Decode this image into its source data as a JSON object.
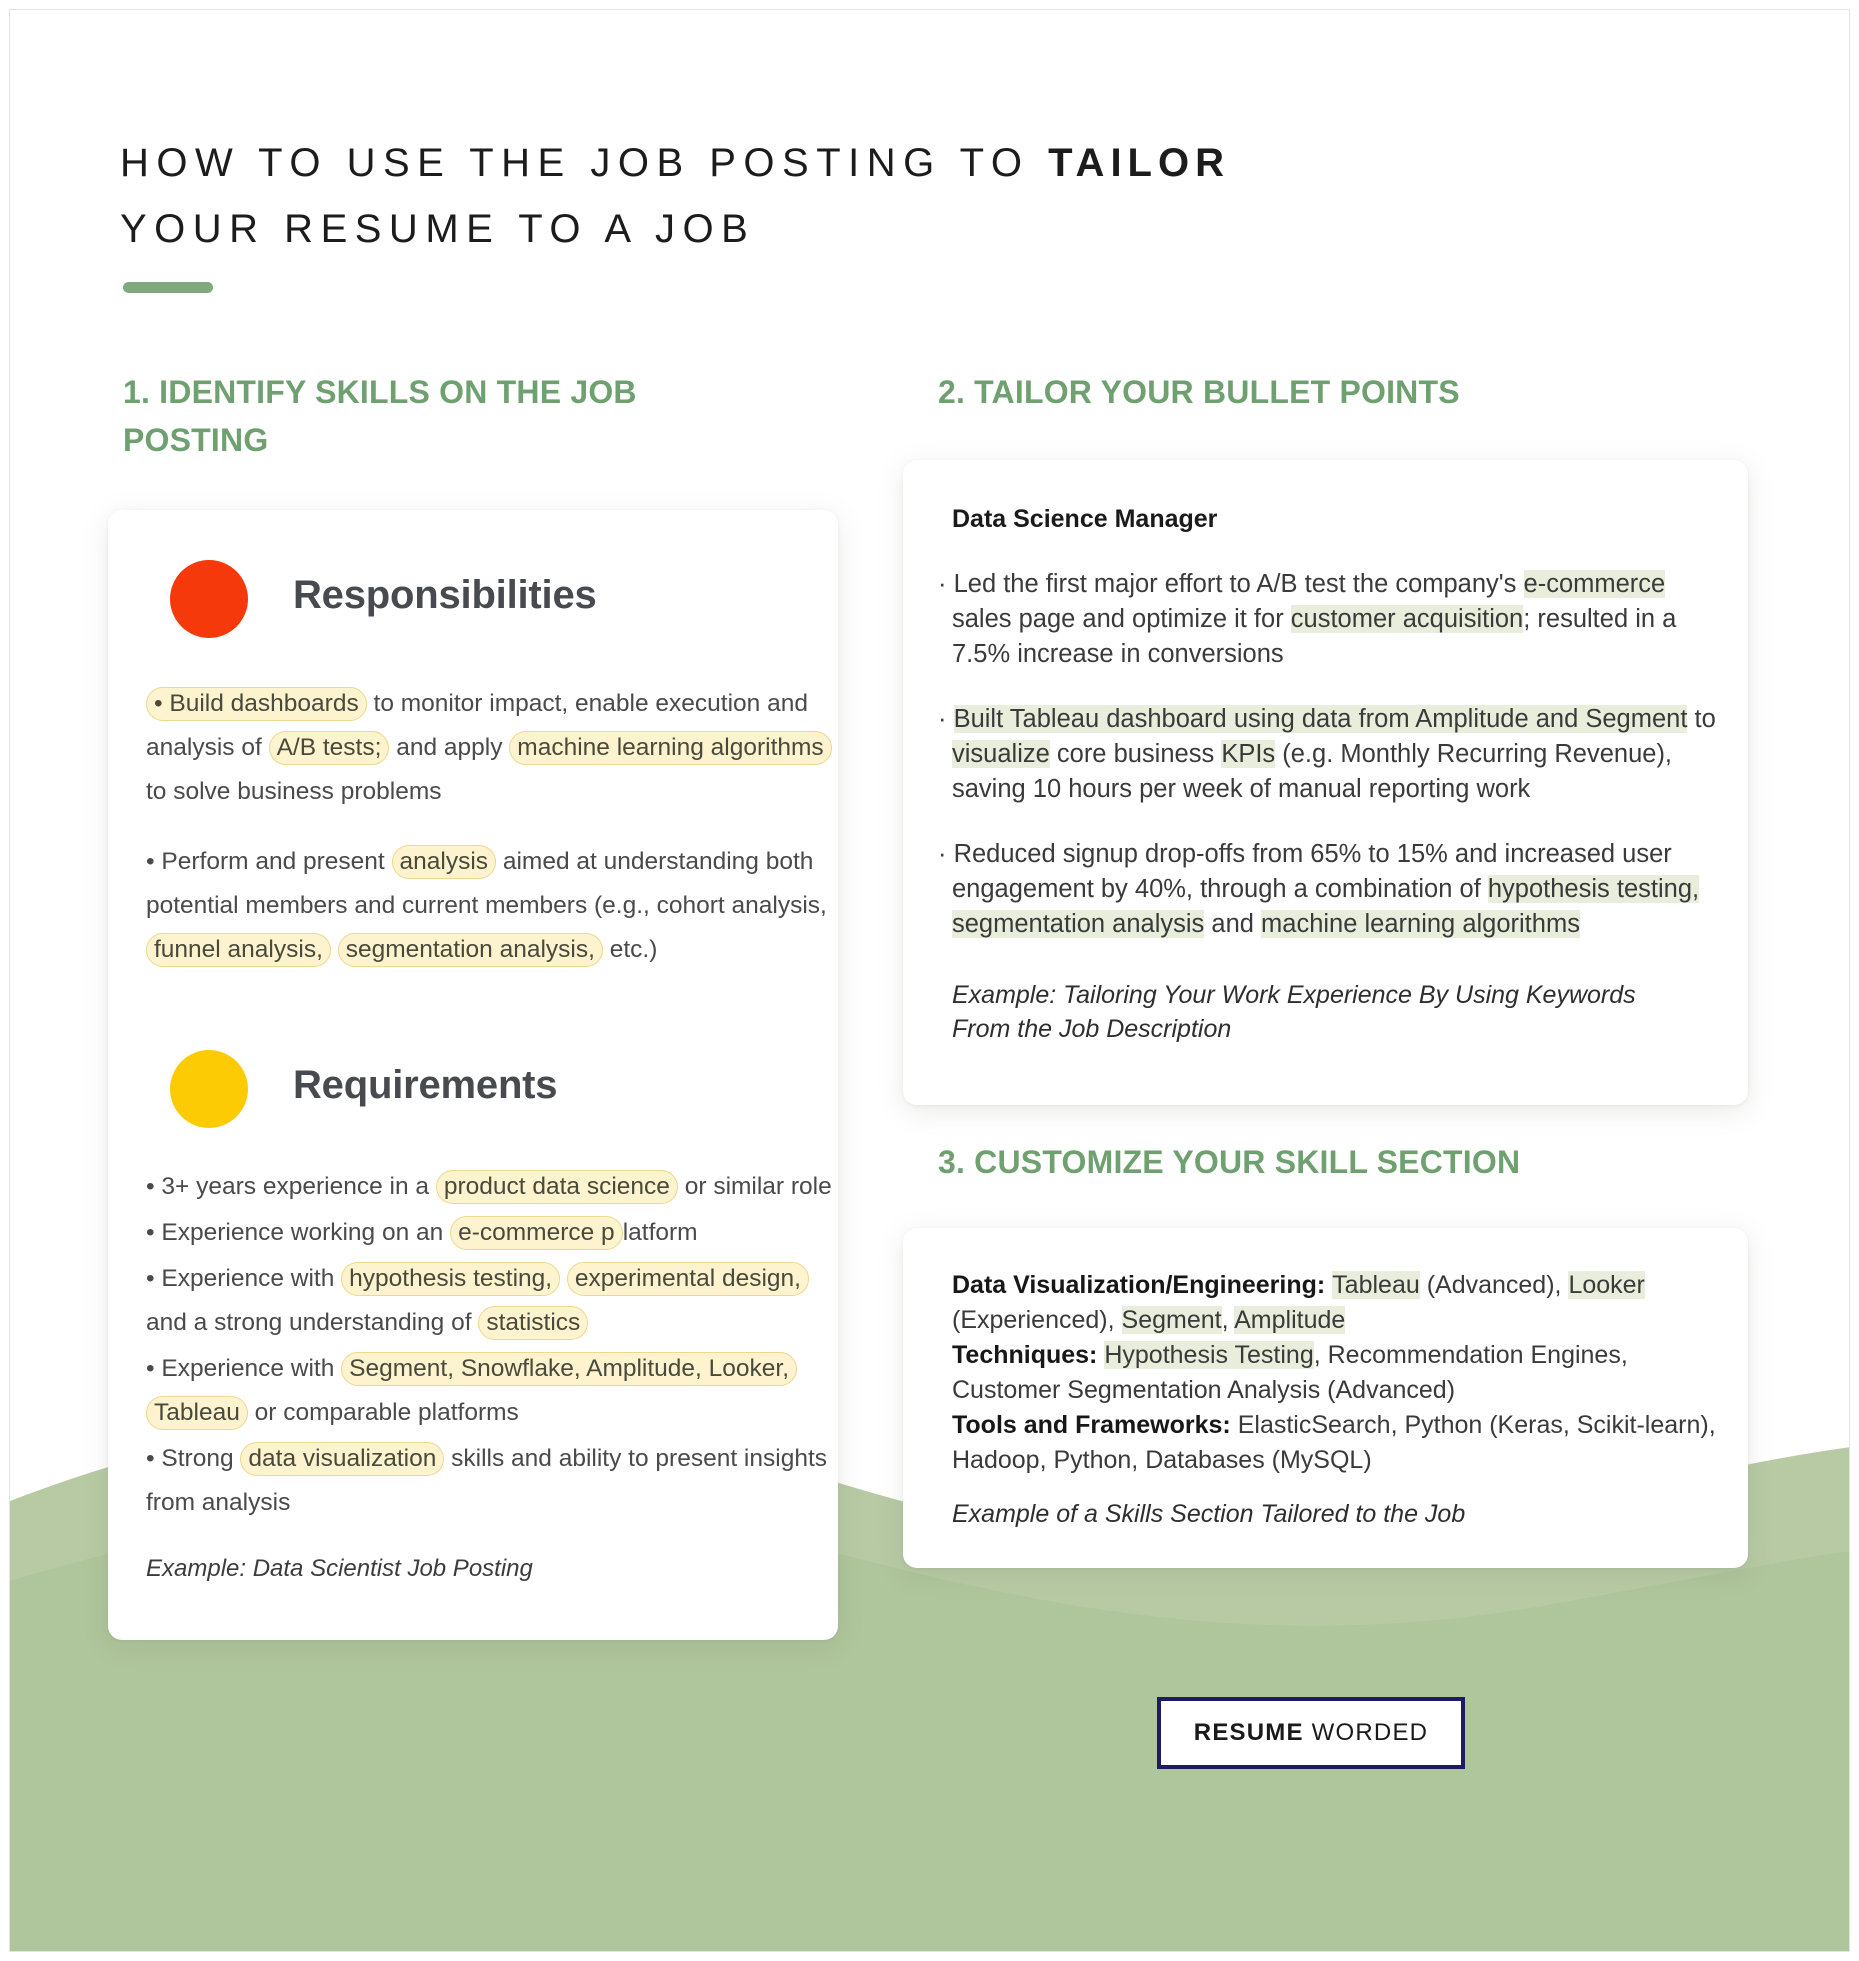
{
  "title": {
    "line1_before": "HOW TO USE THE JOB POSTING TO ",
    "line1_bold": "TAILOR",
    "line2": "YOUR RESUME TO A JOB"
  },
  "colors": {
    "accent_green": "#7fa97f",
    "heading_green": "#6fa06f",
    "responsibilities_dot": "#f5390a",
    "requirements_dot": "#fdcb03",
    "highlight_yellow": "#fdf4cf",
    "highlight_green": "#e9eedc",
    "logo_border_navy": "#1e1b63",
    "wave_green": "#aec49a"
  },
  "sections": {
    "one": {
      "heading": "1. IDENTIFY SKILLS ON THE JOB POSTING"
    },
    "two": {
      "heading": "2. TAILOR YOUR BULLET POINTS"
    },
    "three": {
      "heading": "3. CUSTOMIZE YOUR SKILL SECTION"
    }
  },
  "job_posting_card": {
    "responsibilities": {
      "label": "Responsibilities",
      "dot_icon": "red-circle-icon",
      "bullets": [
        [
          {
            "t": "• Build dashboards",
            "h": "yellow"
          },
          {
            "t": " to monitor impact, enable execution and analysis of ",
            "h": "none"
          },
          {
            "t": "A/B tests;",
            "h": "yellow"
          },
          {
            "t": " and apply ",
            "h": "none"
          },
          {
            "t": "machine learning algorithms",
            "h": "yellow"
          },
          {
            "t": " to solve business problems",
            "h": "none"
          }
        ],
        [
          {
            "t": "• Perform and present ",
            "h": "none"
          },
          {
            "t": "analysis",
            "h": "yellow"
          },
          {
            "t": " aimed at understanding both potential members and current members (e.g., cohort analysis, ",
            "h": "none"
          },
          {
            "t": "funnel analysis,",
            "h": "yellow"
          },
          {
            "t": " ",
            "h": "none"
          },
          {
            "t": "segmentation analysis,",
            "h": "yellow"
          },
          {
            "t": " etc.)",
            "h": "none"
          }
        ]
      ]
    },
    "requirements": {
      "label": "Requirements",
      "dot_icon": "yellow-circle-icon",
      "bullets": [
        [
          {
            "t": "• 3+ years experience in a ",
            "h": "none"
          },
          {
            "t": "product data science",
            "h": "yellow"
          },
          {
            "t": " or similar role",
            "h": "none"
          }
        ],
        [
          {
            "t": "• Experience working on an ",
            "h": "none"
          },
          {
            "t": "e-commerce p",
            "h": "yellow"
          },
          {
            "t": "latform",
            "h": "none"
          }
        ],
        [
          {
            "t": "• Experience with ",
            "h": "none"
          },
          {
            "t": "hypothesis testing,",
            "h": "yellow"
          },
          {
            "t": " ",
            "h": "none"
          },
          {
            "t": "experimental design,",
            "h": "yellow"
          },
          {
            "t": " and a strong understanding of ",
            "h": "none"
          },
          {
            "t": "statistics",
            "h": "yellow"
          }
        ],
        [
          {
            "t": "• Experience with ",
            "h": "none"
          },
          {
            "t": "Segment, Snowflake, Amplitude, Looker,",
            "h": "yellow"
          },
          {
            "t": " ",
            "h": "none"
          },
          {
            "t": "Tableau",
            "h": "yellow"
          },
          {
            "t": " or comparable platforms",
            "h": "none"
          }
        ],
        [
          {
            "t": "• Strong ",
            "h": "none"
          },
          {
            "t": "data visualization",
            "h": "yellow"
          },
          {
            "t": " skills and ability to present insights from analysis",
            "h": "none"
          }
        ]
      ]
    },
    "example_note": "Example: Data Scientist Job Posting"
  },
  "bullet_points_card": {
    "job_title": "Data Science Manager",
    "bullets": [
      [
        {
          "t": "· Led the first major effort to A/B test the company's ",
          "h": "none"
        },
        {
          "t": "e-commerce",
          "h": "green"
        },
        {
          "t": " sales page and optimize it for ",
          "h": "none"
        },
        {
          "t": "customer acquisition",
          "h": "green"
        },
        {
          "t": "; resulted in a 7.5% increase in conversions",
          "h": "none"
        }
      ],
      [
        {
          "t": "· ",
          "h": "none"
        },
        {
          "t": "Built Tableau dashboard using data from Amplitude and Segment",
          "h": "green"
        },
        {
          "t": " to ",
          "h": "none"
        },
        {
          "t": "visualize",
          "h": "green"
        },
        {
          "t": " core business ",
          "h": "none"
        },
        {
          "t": "KPIs",
          "h": "green"
        },
        {
          "t": " (e.g. Monthly Recurring Revenue), saving 10 hours per week of manual reporting work",
          "h": "none"
        }
      ],
      [
        {
          "t": "· Reduced signup drop-offs from 65% to 15% and increased user engagement by 40%, through a combination of ",
          "h": "none"
        },
        {
          "t": "hypothesis testing,",
          "h": "green"
        },
        {
          "t": " ",
          "h": "none"
        },
        {
          "t": "segmentation analysis",
          "h": "green"
        },
        {
          "t": " and ",
          "h": "none"
        },
        {
          "t": "machine learning algorithms",
          "h": "green"
        }
      ]
    ],
    "example_note": "Example: Tailoring Your Work Experience By Using Keywords From the Job Description"
  },
  "skills_card": {
    "rows": [
      [
        {
          "t": "Data Visualization/Engineering: ",
          "h": "bold"
        },
        {
          "t": "Tableau",
          "h": "green"
        },
        {
          "t": " (Advanced), ",
          "h": "none"
        },
        {
          "t": "Looker",
          "h": "green"
        },
        {
          "t": " (Experienced), ",
          "h": "none"
        },
        {
          "t": "Segment",
          "h": "green"
        },
        {
          "t": ", ",
          "h": "none"
        },
        {
          "t": "Amplitude",
          "h": "green"
        }
      ],
      [
        {
          "t": "Techniques: ",
          "h": "bold"
        },
        {
          "t": "Hypothesis Testing",
          "h": "green"
        },
        {
          "t": ", Recommendation Engines, Customer Segmentation Analysis (Advanced)",
          "h": "none"
        }
      ],
      [
        {
          "t": "Tools and Frameworks: ",
          "h": "bold"
        },
        {
          "t": "ElasticSearch, Python (Keras, Scikit-learn), Hadoop, Python, Databases (MySQL)",
          "h": "none"
        }
      ]
    ],
    "example_note": "Example of a Skills Section Tailored to the Job"
  },
  "logo": {
    "bold": "RESUME",
    "regular": "WORDED"
  }
}
